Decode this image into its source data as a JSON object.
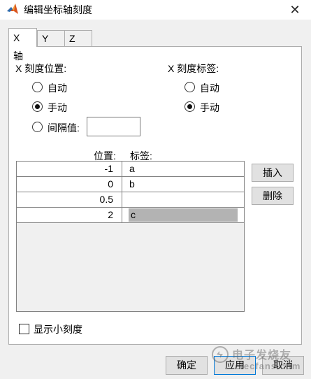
{
  "window": {
    "title": "编辑坐标轴刻度",
    "close_glyph": "✕"
  },
  "tabs": [
    {
      "label": "X 轴",
      "active": true
    },
    {
      "label": "Y 轴",
      "active": false
    },
    {
      "label": "Z 轴",
      "active": false
    }
  ],
  "tick_position": {
    "heading": "X 刻度位置:",
    "options": [
      {
        "label": "自动",
        "checked": false
      },
      {
        "label": "手动",
        "checked": true
      },
      {
        "label": "间隔值:",
        "checked": false
      }
    ],
    "interval_value": ""
  },
  "tick_labels": {
    "heading": "X 刻度标签:",
    "options": [
      {
        "label": "自动",
        "checked": false
      },
      {
        "label": "手动",
        "checked": true
      }
    ]
  },
  "table": {
    "headers": {
      "position": "位置:",
      "label": "标签:"
    },
    "rows": [
      {
        "position": "-1",
        "label": "a"
      },
      {
        "position": "0",
        "label": "b"
      },
      {
        "position": "0.5",
        "label": ""
      },
      {
        "position": "2",
        "label": "c"
      }
    ],
    "selected_row": 3
  },
  "side_buttons": {
    "insert": "插入",
    "delete": "删除"
  },
  "minor_ticks": {
    "label": "显示小刻度",
    "checked": false
  },
  "footer": {
    "ok": "确定",
    "apply": "应用",
    "cancel": "取消"
  },
  "watermark": {
    "text1": "电子发烧友",
    "text2": "elecfans.com"
  }
}
